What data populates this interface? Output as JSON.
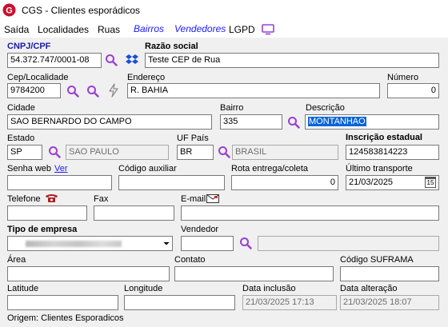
{
  "window": {
    "title": "CGS - Clientes esporádicos"
  },
  "menu": {
    "saida": "Saída",
    "localidades": "Localidades",
    "ruas": "Ruas",
    "bairros": "Bairros",
    "vendedores": "Vendedores",
    "lgpd": "LGPD"
  },
  "form": {
    "cnpj": {
      "label": "CNPJ/CPF",
      "value": "54.372.747/0001-08"
    },
    "razao": {
      "label": "Razão social",
      "value": "Teste CEP de Rua"
    },
    "cep": {
      "label": "Cep/Localidade",
      "value": "9784200"
    },
    "endereco": {
      "label": "Endereço",
      "value": "R. BAHIA"
    },
    "numero": {
      "label": "Número",
      "value": "0"
    },
    "cidade": {
      "label": "Cidade",
      "value": "SAO BERNARDO DO CAMPO"
    },
    "bairro": {
      "label": "Bairro",
      "value": "335"
    },
    "descricao": {
      "label": "Descrição",
      "value": "MONTANHAO"
    },
    "estado": {
      "label": "Estado",
      "value": "SP",
      "nome": "SAO PAULO"
    },
    "uf_pais": {
      "label": "UF País",
      "value": "BR",
      "nome": "BRASIL"
    },
    "inscricao": {
      "label": "Inscrição estadual",
      "value": "124583814223"
    },
    "senha_web": {
      "label": "Senha web",
      "link": "Ver",
      "value": ""
    },
    "codigo_aux": {
      "label": "Código auxiliar",
      "value": ""
    },
    "rota": {
      "label": "Rota entrega/coleta",
      "value": "0"
    },
    "ultimo_transporte": {
      "label": "Último transporte",
      "value": "21/03/2025",
      "cal_day": "15"
    },
    "telefone": {
      "label": "Telefone",
      "value": ""
    },
    "fax": {
      "label": "Fax",
      "value": ""
    },
    "email": {
      "label": "E-mail",
      "value": ""
    },
    "tipo_empresa": {
      "label": "Tipo de empresa"
    },
    "vendedor": {
      "label": "Vendedor",
      "value": ""
    },
    "area": {
      "label": "Área",
      "value": ""
    },
    "contato": {
      "label": "Contato",
      "value": ""
    },
    "suframa": {
      "label": "Código SUFRAMA",
      "value": ""
    },
    "latitude": {
      "label": "Latitude",
      "value": ""
    },
    "longitude": {
      "label": "Longitude",
      "value": ""
    },
    "data_inclusao": {
      "label": "Data inclusão",
      "value": "21/03/2025 17:13"
    },
    "data_alteracao": {
      "label": "Data alteração",
      "value": "21/03/2025 18:07"
    }
  },
  "status": {
    "origem": "Origem: Clientes Esporadicos"
  },
  "colors": {
    "accent": "#1a1aa6",
    "selection": "#0a64d8",
    "menu_link": "#1a1aff",
    "search_icon": "#9b3fd4"
  }
}
